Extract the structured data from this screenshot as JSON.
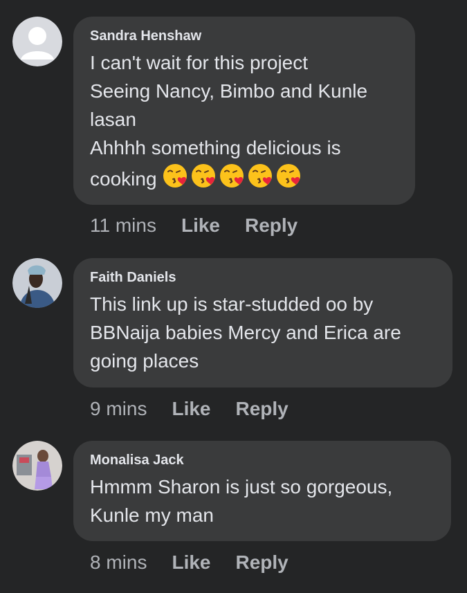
{
  "comments": [
    {
      "author": "Sandra Henshaw",
      "lines": [
        "I can't wait for this project",
        "Seeing Nancy, Bimbo and Kunle",
        "lasan",
        "Ahhhh something delicious is",
        "cooking"
      ],
      "emoji": "kissing-face-with-heart",
      "emoji_count": 5,
      "time": "11 mins",
      "like": "Like",
      "reply": "Reply"
    },
    {
      "author": "Faith Daniels",
      "lines": [
        "This link up is star-studded oo by",
        "BBNaija babies Mercy and Erica are",
        "going places"
      ],
      "time": "9 mins",
      "like": "Like",
      "reply": "Reply"
    },
    {
      "author": "Monalisa Jack",
      "lines": [
        "Hmmm Sharon is just so gorgeous,",
        "Kunle my man"
      ],
      "time": "8 mins",
      "like": "Like",
      "reply": "Reply"
    }
  ],
  "colors": {
    "background": "#242526",
    "bubble": "#3a3b3c",
    "text": "#e4e6eb",
    "secondary": "#b0b3b8"
  }
}
